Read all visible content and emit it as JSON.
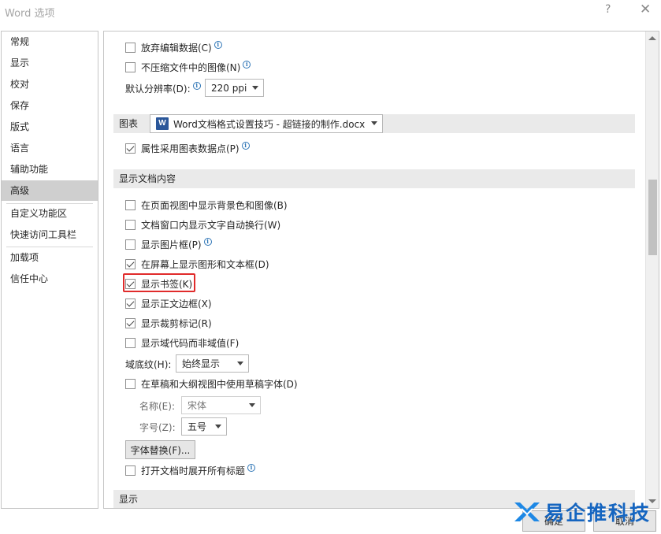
{
  "window": {
    "title": "Word 选项",
    "help": "?",
    "close": "✕"
  },
  "sidebar": {
    "items": [
      "常规",
      "显示",
      "校对",
      "保存",
      "版式",
      "语言",
      "辅助功能",
      "高级",
      "自定义功能区",
      "快速访问工具栏",
      "加载项",
      "信任中心"
    ],
    "active": "高级"
  },
  "content": {
    "image": {
      "discard_edit": "放弃编辑数据(C)",
      "no_compress": "不压缩文件中的图像(N)",
      "default_res_label": "默认分辨率(D):",
      "default_res_value": "220 ppi"
    },
    "chart": {
      "section": "图表",
      "doc_select": "Word文档格式设置技巧 - 超链接的制作.docx",
      "props_follow": "属性采用图表数据点(P)"
    },
    "doc_content": {
      "section": "显示文档内容",
      "items": [
        "在页面视图中显示背景色和图像(B)",
        "文档窗口内显示文字自动换行(W)",
        "显示图片框(P)",
        "在屏幕上显示图形和文本框(D)",
        "显示书签(K)",
        "显示正文边框(X)",
        "显示裁剪标记(R)",
        "显示域代码而非域值(F)"
      ],
      "field_shading_label": "域底纹(H):",
      "field_shading_value": "始终显示",
      "draft_font": "在草稿和大纲视图中使用草稿字体(D)",
      "name_label": "名称(E):",
      "name_value": "宋体",
      "size_label": "字号(Z):",
      "size_value": "五号",
      "font_sub": "字体替换(F)...",
      "expand_headings": "打开文档时展开所有标题"
    },
    "display_section": "显示"
  },
  "footer": {
    "ok": "确定",
    "cancel": "取消"
  },
  "watermark": {
    "text": "易企推科技"
  },
  "colors": {
    "highlight": "#e02b2b",
    "accent": "#2b579a",
    "watermark": "#1565c0"
  }
}
